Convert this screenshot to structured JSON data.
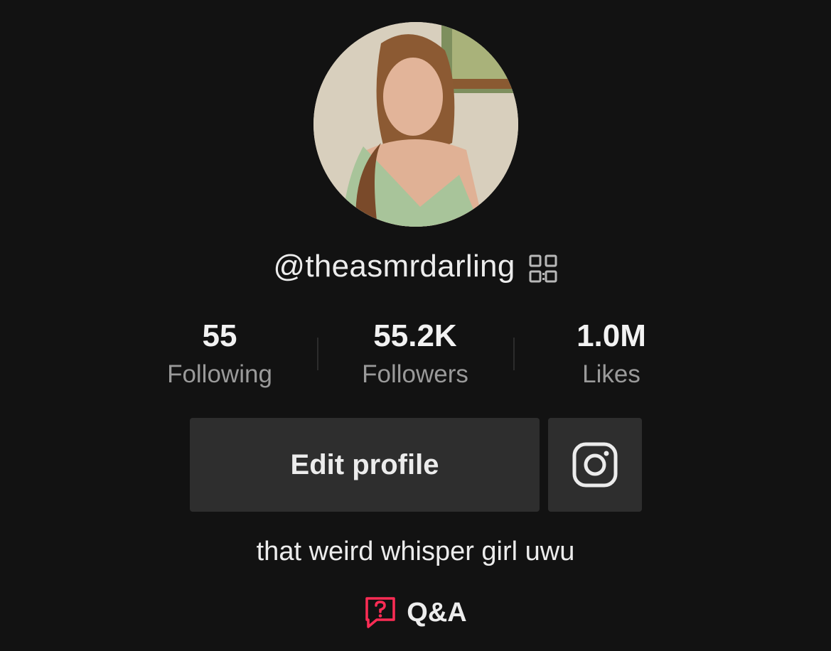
{
  "profile": {
    "username": "@theasmrdarling",
    "bio": "that weird whisper girl uwu"
  },
  "stats": {
    "following_value": "55",
    "following_label": "Following",
    "followers_value": "55.2K",
    "followers_label": "Followers",
    "likes_value": "1.0M",
    "likes_label": "Likes"
  },
  "actions": {
    "edit_profile_label": "Edit profile",
    "instagram_icon": "instagram-icon",
    "qr_icon": "qr-code-icon"
  },
  "qa": {
    "label": "Q&A",
    "icon": "question-bubble-icon"
  },
  "colors": {
    "background": "#121212",
    "button": "#2e2e2e",
    "accent": "#fe2c55"
  }
}
